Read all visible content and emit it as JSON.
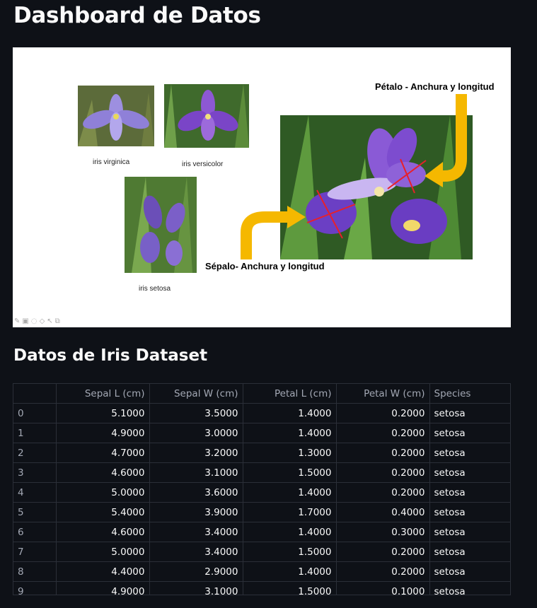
{
  "page": {
    "title": "Dashboard de Datos",
    "section_title": "Datos de Iris Dataset"
  },
  "figure": {
    "captions": {
      "virginica": "iris virginica",
      "versicolor": "iris versicolor",
      "setosa": "iris setosa",
      "petal": "Pétalo - Anchura y longitud",
      "sepal": "Sépalo- Anchura y longitud"
    },
    "colors": {
      "arrow": "#f5b800",
      "measure_line": "#e8202a",
      "flower": "#7a4fc9",
      "leaf": "#3f7a2e"
    },
    "toolbar_icons": [
      "pencil-icon",
      "image-icon",
      "chat-icon",
      "tag-icon",
      "cursor-icon",
      "copy-icon"
    ]
  },
  "table": {
    "columns": [
      "",
      "Sepal L (cm)",
      "Sepal W (cm)",
      "Petal L (cm)",
      "Petal W (cm)",
      "Species"
    ],
    "rows": [
      [
        "0",
        "5.1000",
        "3.5000",
        "1.4000",
        "0.2000",
        "setosa"
      ],
      [
        "1",
        "4.9000",
        "3.0000",
        "1.4000",
        "0.2000",
        "setosa"
      ],
      [
        "2",
        "4.7000",
        "3.2000",
        "1.3000",
        "0.2000",
        "setosa"
      ],
      [
        "3",
        "4.6000",
        "3.1000",
        "1.5000",
        "0.2000",
        "setosa"
      ],
      [
        "4",
        "5.0000",
        "3.6000",
        "1.4000",
        "0.2000",
        "setosa"
      ],
      [
        "5",
        "5.4000",
        "3.9000",
        "1.7000",
        "0.4000",
        "setosa"
      ],
      [
        "6",
        "4.6000",
        "3.4000",
        "1.4000",
        "0.3000",
        "setosa"
      ],
      [
        "7",
        "5.0000",
        "3.4000",
        "1.5000",
        "0.2000",
        "setosa"
      ],
      [
        "8",
        "4.4000",
        "2.9000",
        "1.4000",
        "0.2000",
        "setosa"
      ],
      [
        "9",
        "4.9000",
        "3.1000",
        "1.5000",
        "0.1000",
        "setosa"
      ]
    ]
  }
}
